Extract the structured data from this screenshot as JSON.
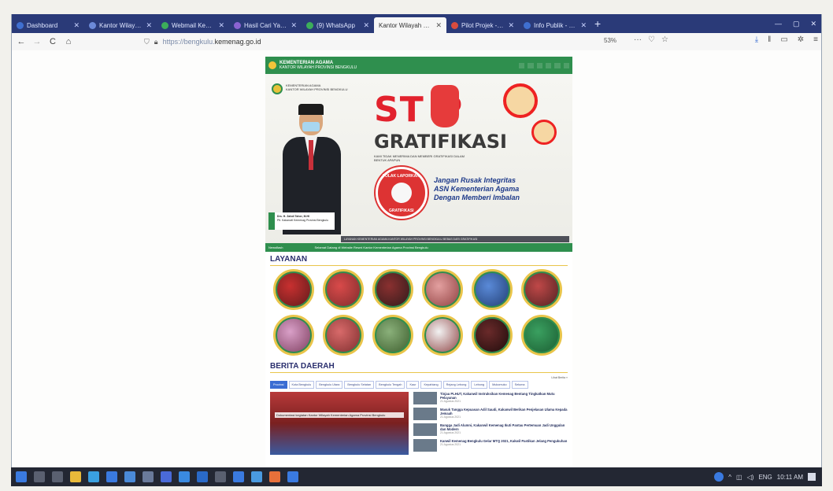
{
  "browser": {
    "tabs": [
      {
        "label": "Dashboard",
        "icon": "dashboard-icon",
        "active": false
      },
      {
        "label": "Kantor Wilayah Keme",
        "icon": "page-icon",
        "active": false
      },
      {
        "label": "Webmail Kemente",
        "icon": "webmail-icon",
        "active": false
      },
      {
        "label": "Hasil Cari Yahoo Se",
        "icon": "yahoo-icon",
        "active": false
      },
      {
        "label": "(9) WhatsApp",
        "icon": "whatsapp-icon",
        "active": false
      },
      {
        "label": "Kantor Wilayah Keme",
        "icon": "page-icon",
        "active": true
      },
      {
        "label": "Pilot Projek - Peni",
        "icon": "page-icon",
        "active": false
      },
      {
        "label": "Info Publik - DPMPT",
        "icon": "page-icon",
        "active": false
      }
    ],
    "new_tab": "+",
    "url_prefix": "https://bengkulu.",
    "url_domain": "kemenag.go.id",
    "zoom": "53%",
    "nav": {
      "back": "←",
      "forward": "→",
      "reload": "C",
      "home": "⌂"
    }
  },
  "site": {
    "brand_top": "KEMENTERIAN AGAMA",
    "brand_sub": "KANTOR WILAYAH PROVINSI BENGKULU",
    "banner": {
      "org_line1": "KEMENTERIAN AGAMA",
      "org_line2": "KANTOR WILAYAH PROVINSI BENGKULU",
      "stop": "ST P",
      "gratifikasi": "GRATIFIKASI",
      "kami": "KAMI TIDAK MENERIMA DAN MEMBERI GRATIFIKASI DALAM BENTUK APAPUN",
      "badge_top": "TOLAK LAPORKAN",
      "badge_bottom": "GRATIFIKASI",
      "slogan_1": "Jangan Rusak Integritas",
      "slogan_2": "ASN Kementerian Agama",
      "slogan_3": "Dengan Memberi Imbalan",
      "strip": "LAYANAN KEMENTERIAN AGAMA KANTOR WILAYAH PROVINSI BENGKULU BEBAS DARI GRATIFIKASI",
      "nametag_1": "Drs. H. Zahdi Taher, M.HI",
      "nametag_2": "Plt. Kakanwil Kemenag Provinsi Bengkulu",
      "ticker_left": "Newsflash",
      "ticker_text": "Selamat Datang di Website Resmi Kantor Kementerian Agama Provinsi Bengkulu"
    },
    "layanan_title": "LAYANAN",
    "layanan_count": 12,
    "berita_title": "BERITA DAERAH",
    "lihat": "Lihat Berita »",
    "categories": [
      "Provinsi",
      "Kota Bengkulu",
      "Bengkulu Utara",
      "Bengkulu Selatan",
      "Bengkulu Tengah",
      "Kaur",
      "Kepahiang",
      "Rejang Lebong",
      "Lebong",
      "Mukomuko",
      "Seluma"
    ],
    "hero_caption": "Dokumentasi kegiatan Kantor Wilayah Kementerian Agama Provinsi Bengkulu",
    "news": [
      {
        "title": "Tinjau PLHUT, Kakanwil Instruksikan Kemenag Bentang Tingkatkan Mutu Pelayanan",
        "date": "21 Agustus 2021"
      },
      {
        "title": "Masuk Tangga Kepuasan Adil Saudi, Kakanwil Berikan Penjelasan Ulama Kepada Jemaah",
        "date": "21 Agustus 2021"
      },
      {
        "title": "Bangga Jadi Alumni, Kakanwil Kemenag Ikuti Pantau Pertemuan Jadi Unggulan dan Modern",
        "date": "21 Agustus 2021"
      },
      {
        "title": "Kanwil Kemenag Bengkulu Gelar MTQ 2021, Kakwil Pastikan Jelang Pengukuhan",
        "date": "21 Agustus 2021"
      }
    ]
  },
  "taskbar": {
    "lang": "ENG",
    "time": "10:11 AM"
  }
}
